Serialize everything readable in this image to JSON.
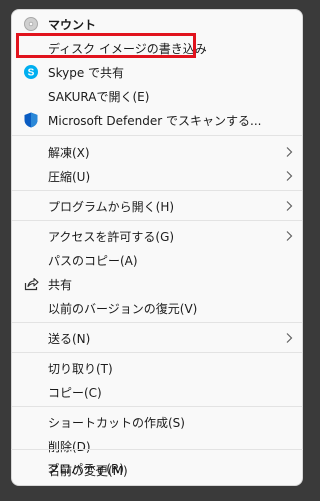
{
  "context_menu": {
    "items": [
      {
        "label": "マウント",
        "icon": "disc-icon",
        "bold": true
      },
      {
        "label": "ディスク イメージの書き込み",
        "icon": "",
        "highlighted": true
      },
      {
        "label": "Skype で共有",
        "icon": "skype-icon"
      },
      {
        "label": "SAKURAで開く(E)",
        "icon": ""
      },
      {
        "label": "Microsoft Defender でスキャンする...",
        "icon": "defender-shield-icon"
      },
      {
        "label": "解凍(X)",
        "submenu": true
      },
      {
        "label": "圧縮(U)",
        "submenu": true
      },
      {
        "label": "プログラムから開く(H)",
        "submenu": true
      },
      {
        "label": "アクセスを許可する(G)",
        "submenu": true
      },
      {
        "label": "パスのコピー(A)"
      },
      {
        "label": "共有",
        "icon": "share-icon"
      },
      {
        "label": "以前のバージョンの復元(V)"
      },
      {
        "label": "送る(N)",
        "submenu": true
      },
      {
        "label": "切り取り(T)"
      },
      {
        "label": "コピー(C)"
      },
      {
        "label": "ショートカットの作成(S)"
      },
      {
        "label": "削除(D)"
      },
      {
        "label": "名前の変更(M)"
      },
      {
        "label": "プロパティ(R)"
      }
    ]
  },
  "colors": {
    "highlight_border": "#e1131d",
    "skype_blue": "#00aff0",
    "defender_blue": "#0a5cc2"
  }
}
